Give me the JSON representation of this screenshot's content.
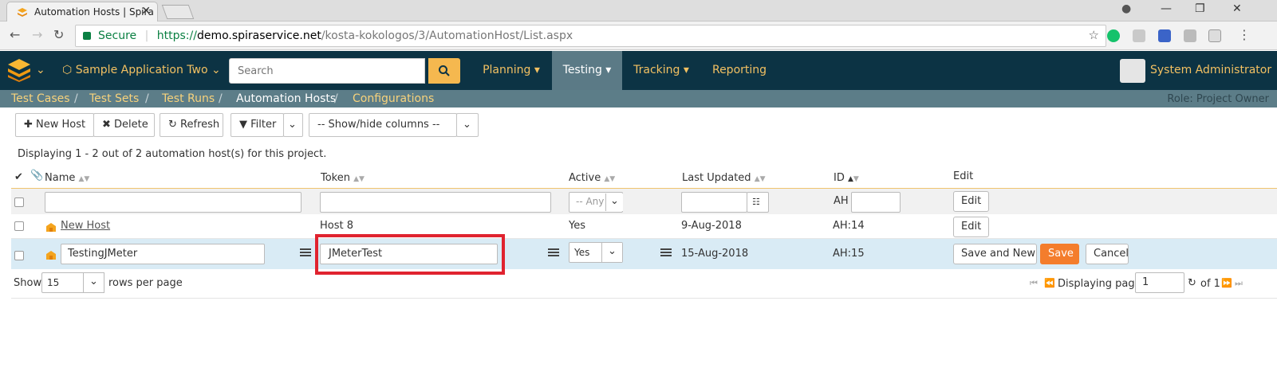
{
  "browser": {
    "tab_title": "Automation Hosts | Spira",
    "tab_close": "✕",
    "secure_label": "Secure",
    "url_scheme": "https://",
    "url_host": "demo.spiraservice.net",
    "url_path": "/kosta-kokologos/3/AutomationHost/List.aspx",
    "win_minimize": "—",
    "win_restore": "❐",
    "win_close": "✕",
    "win_account": "●"
  },
  "header": {
    "project": "Sample Application Two",
    "search_placeholder": "Search",
    "menus": [
      "Planning",
      "Testing",
      "Tracking",
      "Reporting"
    ],
    "user": "System Administrator"
  },
  "subnav": {
    "items": [
      "Test Cases",
      "Test Sets",
      "Test Runs",
      "Automation Hosts",
      "Configurations"
    ],
    "separator": "/",
    "role": "Role: Project Owner"
  },
  "toolbar": {
    "new_host": "New Host",
    "delete": "Delete",
    "refresh": "Refresh",
    "filter": "Filter",
    "show_hide": "-- Show/hide columns --"
  },
  "display_message": "Displaying 1 - 2 out of 2 automation host(s) for this project.",
  "grid": {
    "headers": {
      "name": "Name",
      "token": "Token",
      "active": "Active",
      "last_updated": "Last Updated",
      "id": "ID",
      "edit": "Edit"
    },
    "filter": {
      "active_placeholder": "-- Any --",
      "id_prefix": "AH",
      "edit_button": "Edit"
    },
    "rows": [
      {
        "name": "New Host",
        "token": "Host 8",
        "active": "Yes",
        "last_updated": "9-Aug-2018",
        "id": "AH:14",
        "edit": "Edit"
      },
      {
        "name": "TestingJMeter",
        "token": "JMeterTest",
        "active": "Yes",
        "last_updated": "15-Aug-2018",
        "id": "AH:15",
        "save_and_new": "Save and New",
        "save": "Save",
        "cancel": "Cancel"
      }
    ]
  },
  "pagination": {
    "show": "Show",
    "rows_value": "15",
    "rows_per_page": "rows per page",
    "displaying_page": "Displaying page",
    "page_value": "1",
    "of_pages": "of 1"
  },
  "colors": {
    "header_bg": "#0c3344",
    "accent": "#f2c062",
    "save_button": "#f47d2c",
    "highlight_box": "#e0232f",
    "editing_row": "#d9ebf5"
  }
}
